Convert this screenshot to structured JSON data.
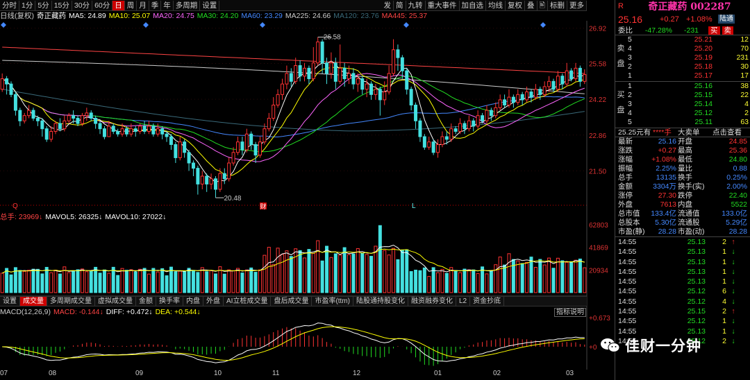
{
  "toolbar": {
    "left": [
      "分时",
      "1分",
      "5分",
      "15分",
      "30分",
      "60分",
      "日",
      "周",
      "月",
      "季",
      "年",
      "多周期",
      "设置"
    ],
    "active": "日",
    "right": [
      "发",
      "简",
      "九转",
      "重大事件",
      "加自选",
      "均线",
      "复权",
      "叠",
      "🖹",
      "标删",
      "更多"
    ]
  },
  "ma_legend": [
    {
      "label": "日线(复权)",
      "color": "#cccccc"
    },
    {
      "label": "奇正藏药",
      "color": "#ffffff"
    },
    {
      "label": "MA5: 24.89",
      "color": "#ffffff"
    },
    {
      "label": "MA10: 25.07",
      "color": "#ffff00"
    },
    {
      "label": "MA20: 24.75",
      "color": "#ff66ff"
    },
    {
      "label": "MA30: 24.20",
      "color": "#22dd22"
    },
    {
      "label": "MA60: 23.29",
      "color": "#4488ff"
    },
    {
      "label": "MA225: 24.66",
      "color": "#cccccc"
    },
    {
      "label": "MA120: 23.76",
      "color": "#3a6a7a"
    },
    {
      "label": "MA445: 25.37",
      "color": "#ff4444"
    }
  ],
  "price_axis": [
    "26.92",
    "25.58",
    "24.22",
    "22.86",
    "21.50"
  ],
  "price_marks": {
    "high": "26.58",
    "low": "20.48"
  },
  "markers": {
    "q": "Q",
    "cai": "财",
    "l": "L"
  },
  "volume_legend": [
    {
      "label": "总手: 23969↓",
      "color": "#ff4444"
    },
    {
      "label": "MAVOL5: 26325↓",
      "color": "#ffffff"
    },
    {
      "label": "MAVOL10: 27022↓",
      "color": "#ffffff"
    }
  ],
  "volume_axis": [
    "62803",
    "41869",
    "20934"
  ],
  "tabs": [
    "设置",
    "成交量",
    "多周期成交量",
    "虚拟成交量",
    "金额",
    "换手率",
    "内盘",
    "外盘",
    "AI立桩成交量",
    "盘后成交量",
    "市盈率(ttm)",
    "陆股通持股变化",
    "融资融券变化",
    "L2",
    "资金抄底"
  ],
  "active_tab": "成交量",
  "macd_legend": [
    {
      "label": "MACD(12,26,9)",
      "color": "#cccccc"
    },
    {
      "label": "MACD: -0.144↓",
      "color": "#ff4444"
    },
    {
      "label": "DIFF: +0.472↓",
      "color": "#ffffff"
    },
    {
      "label": "DEA: +0.544↓",
      "color": "#ffff00"
    }
  ],
  "macd_axis": [
    "+0.673",
    "+0"
  ],
  "indicator_button": "指标说明",
  "months": [
    "07",
    "08",
    "09",
    "10",
    "11",
    "12",
    "01",
    "02",
    "03"
  ],
  "chart_data": {
    "type": "candlestick",
    "title": "奇正藏药 日线(复权)",
    "ylim": [
      20.3,
      27.2
    ],
    "bars": [
      [
        24.6,
        25.0,
        24.5,
        25.2
      ],
      [
        25.0,
        24.8,
        24.4,
        25.1
      ],
      [
        24.8,
        24.4,
        24.3,
        24.9
      ],
      [
        24.4,
        23.8,
        23.6,
        24.5
      ],
      [
        23.8,
        23.4,
        23.2,
        23.9
      ],
      [
        23.4,
        23.6,
        23.3,
        23.7
      ],
      [
        23.6,
        23.8,
        23.5,
        24.0
      ],
      [
        23.8,
        23.5,
        23.4,
        23.9
      ],
      [
        23.5,
        23.4,
        23.2,
        23.6
      ],
      [
        23.4,
        23.1,
        22.8,
        23.5
      ],
      [
        23.1,
        22.7,
        22.6,
        23.2
      ],
      [
        22.7,
        23.0,
        22.6,
        23.2
      ],
      [
        23.0,
        23.3,
        22.9,
        23.4
      ],
      [
        23.3,
        23.1,
        23.0,
        23.5
      ],
      [
        23.1,
        23.4,
        23.0,
        23.6
      ],
      [
        23.4,
        23.6,
        23.3,
        23.7
      ],
      [
        23.6,
        23.5,
        23.3,
        23.8
      ],
      [
        23.5,
        23.3,
        23.2,
        23.6
      ],
      [
        23.3,
        23.6,
        23.2,
        23.7
      ],
      [
        23.6,
        23.7,
        23.4,
        23.9
      ],
      [
        23.7,
        23.5,
        23.4,
        23.8
      ],
      [
        23.5,
        23.3,
        23.1,
        23.6
      ],
      [
        23.3,
        23.1,
        22.9,
        23.4
      ],
      [
        23.1,
        22.8,
        22.7,
        23.2
      ],
      [
        22.8,
        23.2,
        22.8,
        23.4
      ],
      [
        23.2,
        23.0,
        22.9,
        23.3
      ],
      [
        23.0,
        22.9,
        22.8,
        23.1
      ],
      [
        22.9,
        23.1,
        22.8,
        23.3
      ],
      [
        23.1,
        22.9,
        22.8,
        23.2
      ],
      [
        22.9,
        23.1,
        22.8,
        23.3
      ],
      [
        23.1,
        23.0,
        22.8,
        23.2
      ],
      [
        23.0,
        23.2,
        22.9,
        23.3
      ],
      [
        23.2,
        23.0,
        22.9,
        23.4
      ],
      [
        23.0,
        23.2,
        22.9,
        23.4
      ],
      [
        23.2,
        22.9,
        22.8,
        23.3
      ],
      [
        22.9,
        23.1,
        22.8,
        23.3
      ],
      [
        23.1,
        22.9,
        22.7,
        23.2
      ],
      [
        22.9,
        22.8,
        22.6,
        23.0
      ],
      [
        22.8,
        22.5,
        22.3,
        22.9
      ],
      [
        22.5,
        22.0,
        21.8,
        22.6
      ],
      [
        22.0,
        22.6,
        21.9,
        22.8
      ],
      [
        22.6,
        22.2,
        22.0,
        22.7
      ],
      [
        22.2,
        21.8,
        21.5,
        22.3
      ],
      [
        21.8,
        21.6,
        21.3,
        21.9
      ],
      [
        21.6,
        21.0,
        20.6,
        21.7
      ],
      [
        21.0,
        21.3,
        20.8,
        21.5
      ],
      [
        21.3,
        21.0,
        20.7,
        21.4
      ],
      [
        21.0,
        21.2,
        20.8,
        21.4
      ],
      [
        21.2,
        20.8,
        20.48,
        21.3
      ],
      [
        20.8,
        21.4,
        20.7,
        21.6
      ],
      [
        21.4,
        21.2,
        21.0,
        21.6
      ],
      [
        21.2,
        21.8,
        21.1,
        22.0
      ],
      [
        21.8,
        22.2,
        21.7,
        22.4
      ],
      [
        22.2,
        22.6,
        22.1,
        22.8
      ],
      [
        22.6,
        22.3,
        22.1,
        22.8
      ],
      [
        22.3,
        22.9,
        22.2,
        23.1
      ],
      [
        22.9,
        22.5,
        22.3,
        23.0
      ],
      [
        22.5,
        22.1,
        21.8,
        22.6
      ],
      [
        22.1,
        22.6,
        22.0,
        22.8
      ],
      [
        22.6,
        23.1,
        22.5,
        23.3
      ],
      [
        23.1,
        23.5,
        23.0,
        23.7
      ],
      [
        23.5,
        24.0,
        23.4,
        24.3
      ],
      [
        24.0,
        24.4,
        23.9,
        24.6
      ],
      [
        24.4,
        24.8,
        24.2,
        25.0
      ],
      [
        24.8,
        25.2,
        24.6,
        25.5
      ],
      [
        25.2,
        24.9,
        24.7,
        25.4
      ],
      [
        24.9,
        25.5,
        24.8,
        25.8
      ],
      [
        25.5,
        25.1,
        24.9,
        25.7
      ],
      [
        25.1,
        25.4,
        24.9,
        25.6
      ],
      [
        25.4,
        25.0,
        24.8,
        25.5
      ],
      [
        25.0,
        25.6,
        24.9,
        26.2
      ],
      [
        25.6,
        26.4,
        25.5,
        26.58
      ],
      [
        26.4,
        25.6,
        25.2,
        26.5
      ],
      [
        25.6,
        25.2,
        24.8,
        25.8
      ],
      [
        25.2,
        25.6,
        25.0,
        26.0
      ],
      [
        25.6,
        24.9,
        24.6,
        25.8
      ],
      [
        24.9,
        25.4,
        24.8,
        26.3
      ],
      [
        25.4,
        25.0,
        24.7,
        25.6
      ],
      [
        25.0,
        25.2,
        24.8,
        25.5
      ],
      [
        25.2,
        24.8,
        24.6,
        25.4
      ],
      [
        24.8,
        25.0,
        24.5,
        25.2
      ],
      [
        25.0,
        24.6,
        24.4,
        25.1
      ],
      [
        24.6,
        24.8,
        24.3,
        25.0
      ],
      [
        24.8,
        24.4,
        24.2,
        24.9
      ],
      [
        24.4,
        24.6,
        24.2,
        24.8
      ],
      [
        24.6,
        24.2,
        23.6,
        24.7
      ],
      [
        24.2,
        24.5,
        24.0,
        24.9
      ],
      [
        24.5,
        25.2,
        24.4,
        25.5
      ],
      [
        25.2,
        26.1,
        25.1,
        26.5
      ],
      [
        26.1,
        25.8,
        25.3,
        26.3
      ],
      [
        25.8,
        25.3,
        25.0,
        25.9
      ],
      [
        25.3,
        24.6,
        24.4,
        25.4
      ],
      [
        24.6,
        24.0,
        23.8,
        24.7
      ],
      [
        24.0,
        23.4,
        23.1,
        24.1
      ],
      [
        23.4,
        22.8,
        22.6,
        23.5
      ],
      [
        22.8,
        22.4,
        22.3,
        22.9
      ],
      [
        22.4,
        22.6,
        22.3,
        22.8
      ],
      [
        22.6,
        22.2,
        22.1,
        22.7
      ],
      [
        22.2,
        22.5,
        22.0,
        22.7
      ],
      [
        22.5,
        22.8,
        22.4,
        23.0
      ],
      [
        22.8,
        22.7,
        22.5,
        23.0
      ],
      [
        22.7,
        23.1,
        22.6,
        23.3
      ],
      [
        23.1,
        23.0,
        22.9,
        23.2
      ],
      [
        23.0,
        23.3,
        22.9,
        23.5
      ],
      [
        23.3,
        23.1,
        22.9,
        23.4
      ],
      [
        23.1,
        23.4,
        23.0,
        23.6
      ],
      [
        23.4,
        23.2,
        23.0,
        23.5
      ],
      [
        23.2,
        23.6,
        23.1,
        23.8
      ],
      [
        23.6,
        23.4,
        23.3,
        23.7
      ],
      [
        23.4,
        23.8,
        23.3,
        24.0
      ],
      [
        23.8,
        23.6,
        23.4,
        23.9
      ],
      [
        23.6,
        23.9,
        23.5,
        24.1
      ],
      [
        23.9,
        24.2,
        23.8,
        24.4
      ],
      [
        24.2,
        24.0,
        23.9,
        24.4
      ],
      [
        24.0,
        24.3,
        23.9,
        24.6
      ],
      [
        24.3,
        24.1,
        23.9,
        24.4
      ],
      [
        24.1,
        24.4,
        24.0,
        24.6
      ],
      [
        24.4,
        24.2,
        24.0,
        24.5
      ],
      [
        24.2,
        24.5,
        24.1,
        24.7
      ],
      [
        24.5,
        24.3,
        24.1,
        24.6
      ],
      [
        24.3,
        24.6,
        24.2,
        24.8
      ],
      [
        24.6,
        24.4,
        24.2,
        24.7
      ],
      [
        24.4,
        24.7,
        24.3,
        24.9
      ],
      [
        24.7,
        24.9,
        24.5,
        25.1
      ],
      [
        24.9,
        24.6,
        24.5,
        25.0
      ],
      [
        24.6,
        25.1,
        24.5,
        25.3
      ],
      [
        25.1,
        24.8,
        24.6,
        25.2
      ],
      [
        24.8,
        25.3,
        24.7,
        25.6
      ],
      [
        25.3,
        25.0,
        24.9,
        25.4
      ],
      [
        25.0,
        25.4,
        24.9,
        25.6
      ],
      [
        25.4,
        24.9,
        24.7,
        25.5
      ],
      [
        24.9,
        25.16,
        24.8,
        25.36
      ]
    ]
  },
  "right_panel": {
    "code_prefix": "R",
    "name": "奇正藏药",
    "code": "002287",
    "price": "25.16",
    "change": "+0.27",
    "pct": "+1.08%",
    "tag": "陆通",
    "weibi_label": "委比",
    "weibi_pct": "-47.28%",
    "weibi_diff": "-231",
    "btn_buy": "买",
    "btn_sell": "卖",
    "sell_label": "卖盘",
    "buy_label": "买盘",
    "asks": [
      [
        "5",
        "25.21",
        "12"
      ],
      [
        "4",
        "25.20",
        "70"
      ],
      [
        "3",
        "25.19",
        "231"
      ],
      [
        "2",
        "25.18",
        "30"
      ],
      [
        "1",
        "25.17",
        "17"
      ]
    ],
    "bids": [
      [
        "1",
        "25.16",
        "38"
      ],
      [
        "2",
        "25.15",
        "22"
      ],
      [
        "3",
        "25.14",
        "4"
      ],
      [
        "4",
        "25.12",
        "2"
      ],
      [
        "5",
        "25.11",
        "63"
      ]
    ],
    "deal_line": {
      "price": "25.25元有",
      "qty": "****手",
      "big": "大卖单",
      "action": "点击查看"
    },
    "quote": [
      [
        "最新",
        "25.16",
        "开盘",
        "24.85"
      ],
      [
        "涨跌",
        "+0.27",
        "最高",
        "25.36"
      ],
      [
        "涨幅",
        "+1.08%",
        "最低",
        "24.80"
      ],
      [
        "振幅",
        "2.25%",
        "量比",
        "0.88"
      ],
      [
        "总手",
        "13135",
        "换手",
        "0.25%"
      ],
      [
        "金额",
        "3304万",
        "换手(实)",
        "2.00%"
      ],
      [
        "涨停",
        "27.30",
        "跌停",
        "22.40"
      ],
      [
        "外盘",
        "7613",
        "内盘",
        "5522"
      ],
      [
        "总市值",
        "133.4亿",
        "流通值",
        "133.0亿"
      ],
      [
        "总股本",
        "5.30亿",
        "流通股",
        "5.29亿"
      ],
      [
        "市盈(静)",
        "28.28",
        "市盈(动)",
        "28.28"
      ]
    ],
    "ticks": [
      [
        "14:55",
        "25.13",
        "2",
        "up"
      ],
      [
        "14:55",
        "25.13",
        "1",
        "down"
      ],
      [
        "14:55",
        "25.13",
        "1",
        "down"
      ],
      [
        "14:55",
        "25.13",
        "1",
        "down"
      ],
      [
        "14:55",
        "25.13",
        "1",
        "down"
      ],
      [
        "14:55",
        "25.12",
        "6",
        "down"
      ],
      [
        "14:55",
        "25.12",
        "4",
        "down"
      ],
      [
        "14:55",
        "25.15",
        "2",
        "up"
      ],
      [
        "14:55",
        "25.12",
        "1",
        "down"
      ],
      [
        "14:55",
        "25.13",
        "1",
        "down"
      ],
      [
        "14:55",
        "25.12",
        "2",
        "down"
      ]
    ]
  },
  "watermark": "佳财一分钟"
}
